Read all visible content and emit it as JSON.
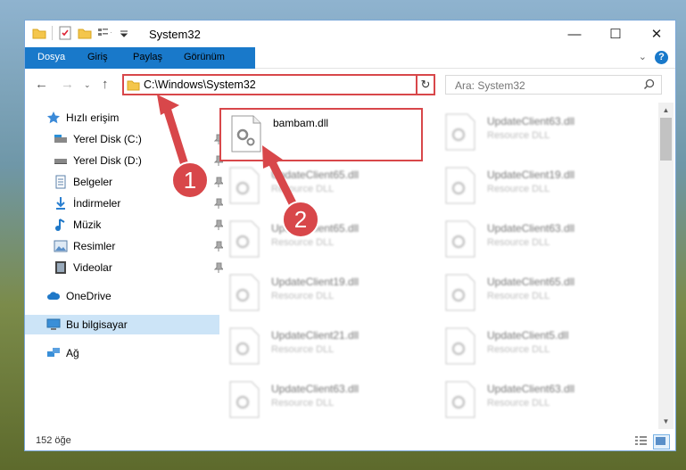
{
  "window": {
    "title": "System32",
    "minimize_icon": "minimize-icon",
    "maximize_icon": "maximize-icon",
    "close_icon": "close-icon"
  },
  "ribbon": {
    "tabs": [
      "Dosya",
      "Giriş",
      "Paylaş",
      "Görünüm"
    ],
    "help": "?"
  },
  "address": {
    "path": "C:\\Windows\\System32",
    "search_placeholder": "Ara: System32"
  },
  "nav": {
    "quick_access": "Hızlı erişim",
    "items": [
      {
        "label": "Yerel Disk (C:)",
        "icon": "drive-icon",
        "pinned": true
      },
      {
        "label": "Yerel Disk (D:)",
        "icon": "drive-icon",
        "pinned": true
      },
      {
        "label": "Belgeler",
        "icon": "documents-icon",
        "pinned": true
      },
      {
        "label": "İndirmeler",
        "icon": "downloads-icon",
        "pinned": true
      },
      {
        "label": "Müzik",
        "icon": "music-icon",
        "pinned": true
      },
      {
        "label": "Resimler",
        "icon": "pictures-icon",
        "pinned": true
      },
      {
        "label": "Videolar",
        "icon": "videos-icon",
        "pinned": true
      }
    ],
    "onedrive": "OneDrive",
    "this_pc": "Bu bilgisayar",
    "network": "Ağ"
  },
  "files": {
    "highlighted": {
      "name": "bambam.dll"
    },
    "left_column": [
      {
        "name": "UpdateClient65.dll",
        "type": "Resource DLL"
      },
      {
        "name": "UpdateClient65.dll",
        "type": "Resource DLL"
      },
      {
        "name": "UpdateClient19.dll",
        "type": "Resource DLL"
      },
      {
        "name": "UpdateClient21.dll",
        "type": "Resource DLL"
      },
      {
        "name": "UpdateClient63.dll",
        "type": "Resource DLL"
      }
    ],
    "right_column": [
      {
        "name": "UpdateClient63.dll",
        "type": "Resource DLL"
      },
      {
        "name": "UpdateClient19.dll",
        "type": "Resource DLL"
      },
      {
        "name": "UpdateClient63.dll",
        "type": "Resource DLL"
      },
      {
        "name": "UpdateClient65.dll",
        "type": "Resource DLL"
      },
      {
        "name": "UpdateClient5.dll",
        "type": "Resource DLL"
      },
      {
        "name": "UpdateClient63.dll",
        "type": "Resource DLL"
      }
    ]
  },
  "status": {
    "count": "152 öğe"
  },
  "annotations": {
    "step1": "1",
    "step2": "2",
    "color": "#d8474a"
  }
}
